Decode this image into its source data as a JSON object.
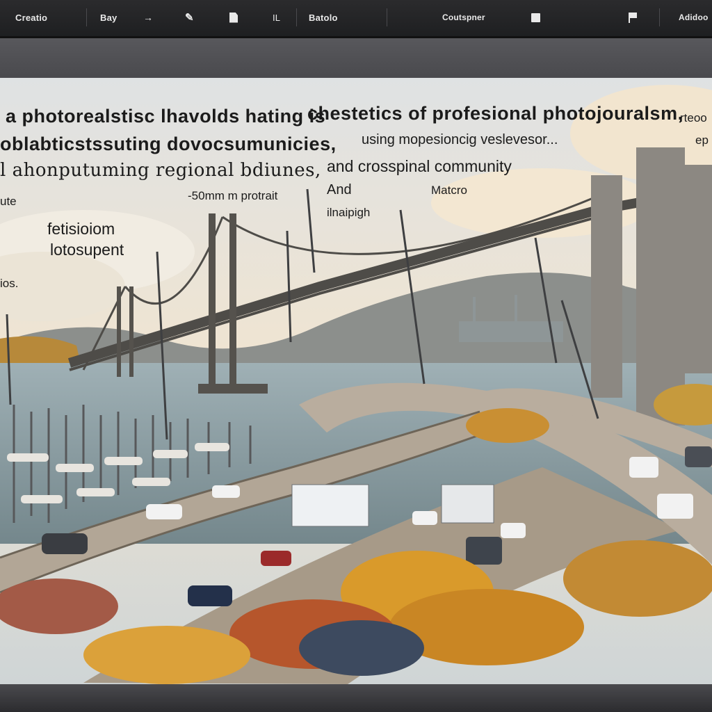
{
  "toolbar": {
    "items": [
      {
        "label": "Creatio"
      },
      {
        "label": "Bay"
      },
      {
        "label": "Batolo"
      },
      {
        "label": "Coutspner"
      },
      {
        "label": "IL"
      },
      {
        "label": "Adidoo"
      }
    ],
    "icons": [
      "arrow-icon",
      "pencil-icon",
      "document-icon",
      "square-icon",
      "flag-icon"
    ]
  },
  "canvas": {
    "lines": [
      "a photorealstisc lhavolds hating is",
      "chestetics of profesional photojouralsm,",
      "rteoo",
      "ep",
      "oblabticstssuting dovocsumunicies,",
      "using mopesioncig veslevesor...",
      "l ahonputuming regional bdiunes,",
      "and crosspinal community",
      "ute",
      "-50mm m protrait",
      "And",
      "Matcro",
      "ilnaipigh",
      "fetisioiom",
      "lotosupent",
      "ios."
    ]
  },
  "colors": {
    "toolbar_bg": "#1e1f21",
    "bezel": "#4a4a4e",
    "bridge_steel": "#5a5752",
    "road": "#b7ab9d",
    "shrub_orange": "#d99a2b"
  }
}
